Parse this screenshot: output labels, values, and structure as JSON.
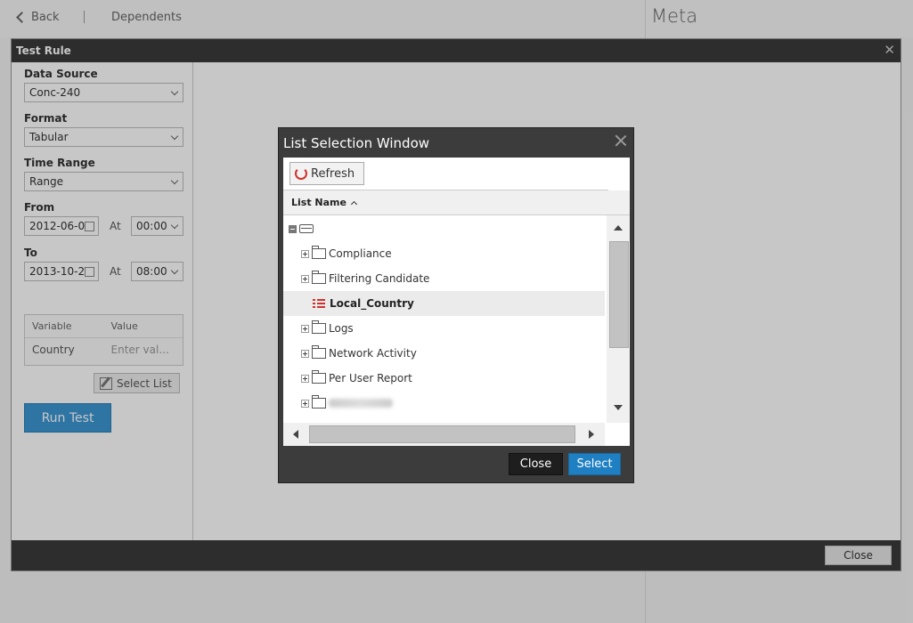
{
  "background": {
    "back_label": "Back",
    "dependents_label": "Dependents",
    "meta_title": "Meta"
  },
  "test_rule": {
    "title": "Test Rule",
    "data_source_label": "Data Source",
    "data_source_value": "Conc-240",
    "format_label": "Format",
    "format_value": "Tabular",
    "time_range_label": "Time Range",
    "time_range_value": "Range",
    "from_label": "From",
    "from_date": "2012-06-0",
    "from_time": "00:00",
    "to_label": "To",
    "to_date": "2013-10-2",
    "to_time": "08:00",
    "at_label": "At",
    "variable_header": "Variable",
    "value_header": "Value",
    "variable_row_name": "Country",
    "variable_row_placeholder": "Enter val...",
    "select_list_label": "Select List",
    "run_test_label": "Run Test",
    "close_label": "Close"
  },
  "list_selection": {
    "title": "List Selection Window",
    "refresh_label": "Refresh",
    "column_header": "List Name",
    "items": [
      {
        "label": "Compliance"
      },
      {
        "label": "Filtering Candidate"
      },
      {
        "label": "Local_Country"
      },
      {
        "label": "Logs"
      },
      {
        "label": "Network Activity"
      },
      {
        "label": "Per User Report"
      }
    ],
    "close_label": "Close",
    "select_label": "Select"
  },
  "colors": {
    "accent_blue": "#1e7fc2",
    "list_icon_red": "#d0312d",
    "header_dark": "#3c3c3c"
  }
}
